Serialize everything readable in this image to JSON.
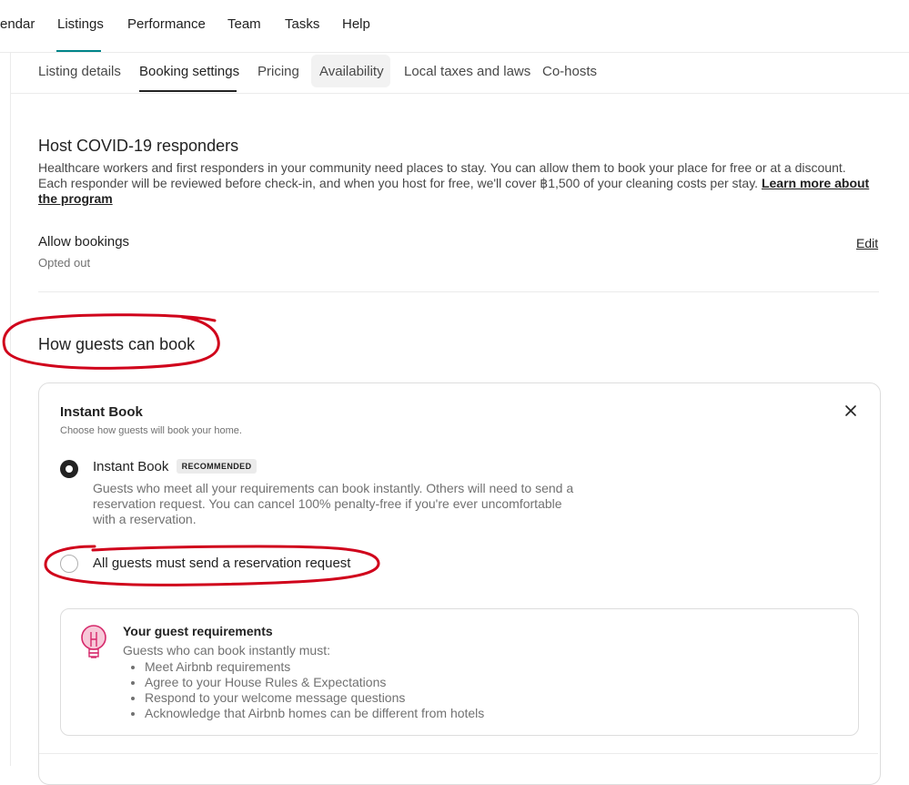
{
  "top_nav": {
    "items": [
      "endar",
      "Listings",
      "Performance",
      "Team",
      "Tasks",
      "Help"
    ],
    "active": "Listings"
  },
  "sub_tabs": {
    "items": [
      "Listing details",
      "Booking settings",
      "Pricing",
      "Availability",
      "Local taxes and laws",
      "Co-hosts"
    ],
    "active": "Booking settings",
    "hovered": "Availability"
  },
  "covid": {
    "title": "Host COVID-19 responders",
    "description": "Healthcare workers and first responders in your community need places to stay. You can allow them to book your place for free or at a discount. Each responder will be reviewed before check-in, and when you host for free, we'll cover ฿1,500 of your cleaning costs per stay.",
    "learn_more_link": "Learn more about the program",
    "setting_label": "Allow bookings",
    "setting_value": "Opted out",
    "edit_link": "Edit"
  },
  "how_guests": {
    "title": "How guests can book"
  },
  "instant_book": {
    "title": "Instant Book",
    "subtitle": "Choose how guests will book your home.",
    "close_icon": "close-icon",
    "options": [
      {
        "label": "Instant Book",
        "badge": "RECOMMENDED",
        "description": "Guests who meet all your requirements can book instantly. Others will need to send a reservation request. You can cancel 100% penalty-free if you're ever uncomfortable with a reservation.",
        "checked": true
      },
      {
        "label": "All guests must send a reservation request",
        "checked": false
      }
    ],
    "requirements": {
      "icon": "lightbulb-icon",
      "title": "Your guest requirements",
      "intro": "Guests who can book instantly must:",
      "items": [
        "Meet Airbnb requirements",
        "Agree to your House Rules & Expectations",
        "Respond to your welcome message questions",
        "Acknowledge that Airbnb homes can be different from hotels"
      ]
    }
  },
  "colors": {
    "accent_teal": "#008489",
    "annotation_red": "#d0021b",
    "bulb_pink": "#d6296b"
  }
}
